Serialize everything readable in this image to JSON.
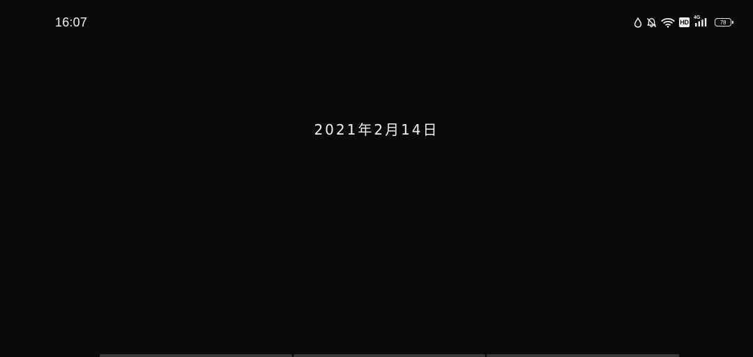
{
  "status_bar": {
    "time": "16:07",
    "icons": [
      "droplet-icon",
      "bell-off-icon",
      "wifi-icon",
      "hd-icon",
      "signal-icon",
      "battery-icon"
    ],
    "hd_label": "HD",
    "network_type": "4G",
    "battery_level": "78"
  },
  "main": {
    "date": "2021年2月14日"
  },
  "colors": {
    "background": "#0a0a0a",
    "text": "#f2f2f2",
    "bottom_tab": "#3a3a3a"
  }
}
